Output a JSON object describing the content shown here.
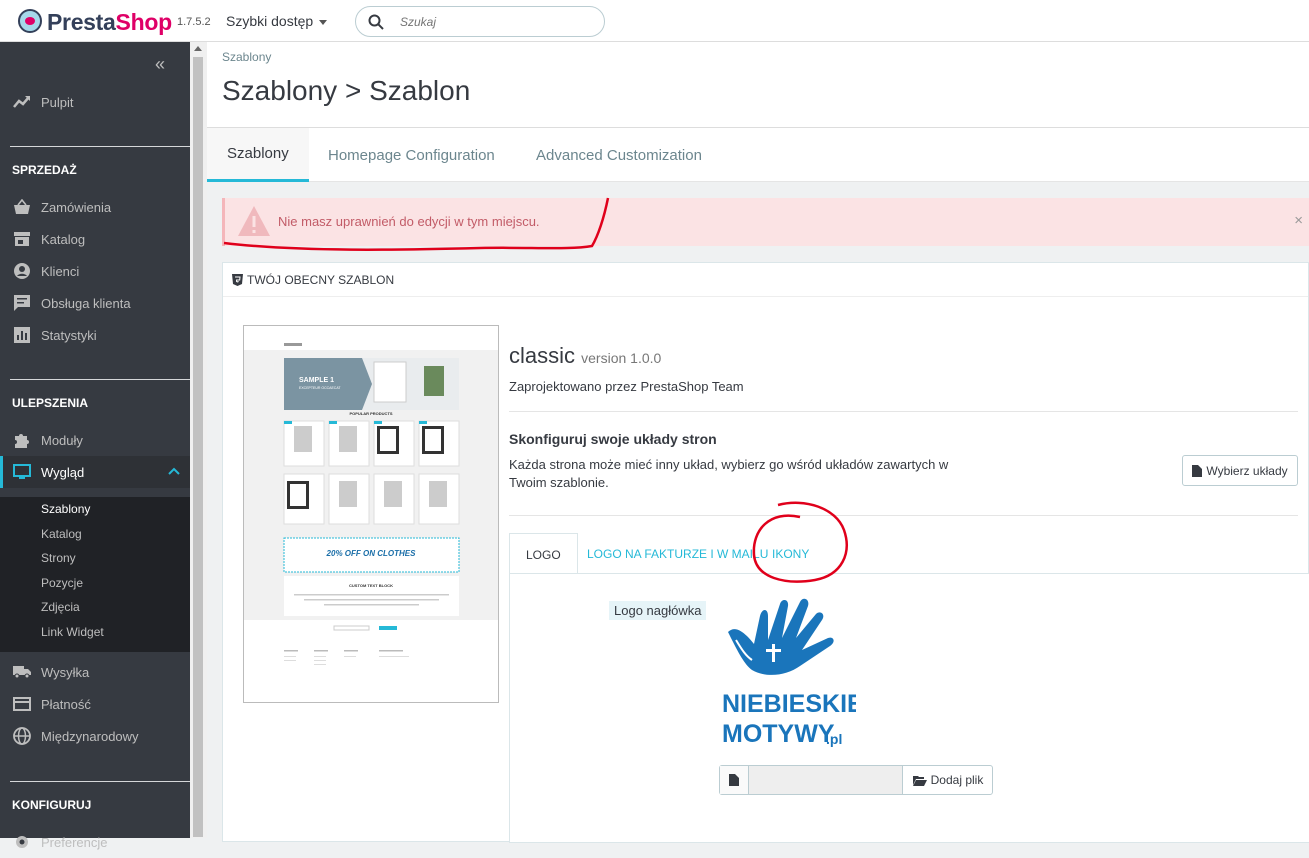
{
  "app": {
    "brand_main": "Presta",
    "brand_accent": "Shop",
    "version": "1.7.5.2",
    "quick_access": "Szybki dostęp"
  },
  "search": {
    "placeholder": "Szukaj"
  },
  "sidebar": {
    "dashboard": "Pulpit",
    "sections": [
      {
        "title": "SPRZEDAŻ",
        "items": [
          "Zamówienia",
          "Katalog",
          "Klienci",
          "Obsługa klienta",
          "Statystyki"
        ]
      },
      {
        "title": "ULEPSZENIA",
        "items": [
          "Moduły",
          "Wygląd"
        ]
      },
      {
        "title": "KONFIGURUJ",
        "items": [
          "Preferencje"
        ]
      }
    ],
    "appearance_sub": [
      "Szablony",
      "Katalog",
      "Strony",
      "Pozycje",
      "Zdjęcia",
      "Link Widget"
    ],
    "after_items": [
      "Wysyłka",
      "Płatność",
      "Międzynarodowy"
    ]
  },
  "header": {
    "breadcrumb": "Szablony",
    "title": "Szablony > Szablon"
  },
  "tabs": [
    "Szablony",
    "Homepage Configuration",
    "Advanced Customization"
  ],
  "alert": {
    "message": "Nie masz uprawnień do edycji w tym miejscu.",
    "close": "×"
  },
  "panel": {
    "heading": "TWÓJ OBECNY SZABLON",
    "theme_name": "classic",
    "theme_version": "version 1.0.0",
    "designed_by": "Zaprojektowano przez PrestaShop Team",
    "configure_title": "Skonfiguruj swoje układy stron",
    "configure_desc": "Każda strona może mieć inny układ, wybierz go wśród układów zawartych w Twoim szablonie.",
    "choose_layouts": "Wybierz układy",
    "logo_tabs": [
      "LOGO",
      "LOGO NA FAKTURZE I W MAILU",
      "IKONY"
    ],
    "logo_label": "Logo nagłówka",
    "add_file": "Dodaj plik"
  },
  "preview": {
    "slide_title": "SAMPLE 1",
    "slide_sub": "EXCEPTEUR OCCAECAT",
    "popular": "POPULAR PRODUCTS",
    "banner": "20% OFF ON CLOTHES",
    "custom_block": "CUSTOM TEXT BLOCK"
  },
  "brand_logo": {
    "line1": "NIEBIESKIE",
    "line2": "MOTYWY",
    "suffix": ".pl",
    "color": "#1a75bb"
  },
  "colors": {
    "accent": "#25b9d7",
    "sidebar": "#363a41",
    "alert_bg": "#fbe3e4",
    "alert_text": "#c25b67",
    "annotation": "#e0001b"
  }
}
